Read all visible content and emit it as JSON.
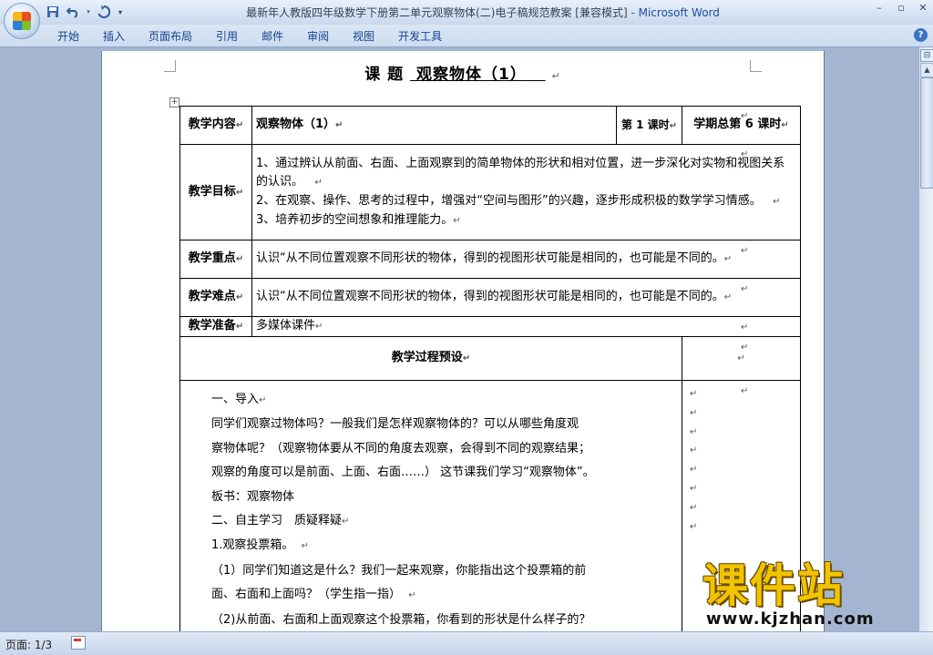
{
  "window": {
    "title": "最新年人教版四年级数学下册第二单元观察物体(二)电子稿规范教案 [兼容模式]",
    "app_name": "- Microsoft Word"
  },
  "quick_access": [
    "save-icon",
    "undo-icon",
    "redo-icon",
    "customize-icon"
  ],
  "window_controls": {
    "minimize": "–",
    "restore": "▫",
    "close": "✕"
  },
  "ribbon": {
    "tabs": [
      "开始",
      "插入",
      "页面布局",
      "引用",
      "邮件",
      "审阅",
      "视图",
      "开发工具"
    ],
    "help": "?"
  },
  "document": {
    "title_prefix": "课 题",
    "title_topic": "观察物体（1）",
    "para_mark": "↵",
    "anchor": "+",
    "rows": {
      "content_label": "教学内容",
      "content_value": "观察物体（1）",
      "period": "第 1 课时",
      "total_period": "学期总第 6 课时",
      "goals_label": "教学目标",
      "goals": [
        "1、通过辨认从前面、右面、上面观察到的简单物体的形状和相对位置，进一步深化对实物和视图关系的认识。",
        "2、在观察、操作、思考的过程中，增强对“空间与图形”的兴趣，逐步形成积极的数学学习情感。",
        "3、培养初步的空间想象和推理能力。"
      ],
      "key_label": "教学重点",
      "key_value": "认识“从不同位置观察不同形状的物体，得到的视图形状可能是相同的，也可能是不同的。",
      "difficulty_label": "教学难点",
      "difficulty_value": "认识“从不同位置观察不同形状的物体，得到的视图形状可能是相同的，也可能是不同的。",
      "prep_label": "教学准备",
      "prep_value": "多媒体课件",
      "process_label": "教学过程预设"
    },
    "process": [
      "一、导入",
      "同学们观察过物体吗？一般我们是怎样观察物体的？可以从哪些角度观",
      "察物体呢？（观察物体要从不同的角度去观察，会得到不同的观察结果；",
      "观察的角度可以是前面、上面、右面……）  这节课我们学习“观察物体”。",
      "板书：观察物体",
      "二、自主学习　质疑释疑",
      "1.观察投票箱。",
      "（1）同学们知道这是什么？我们一起来观察，你能指出这个投票箱的前",
      "面、右面和上面吗？（学生指一指）",
      "（2)从前面、右面和上面观察这个投票箱，你看到的形状是什么样子的？"
    ]
  },
  "status_bar": {
    "page": "页面: 1/3"
  },
  "watermark": {
    "brand": "课件站",
    "url": "www.kjzhan.com"
  }
}
